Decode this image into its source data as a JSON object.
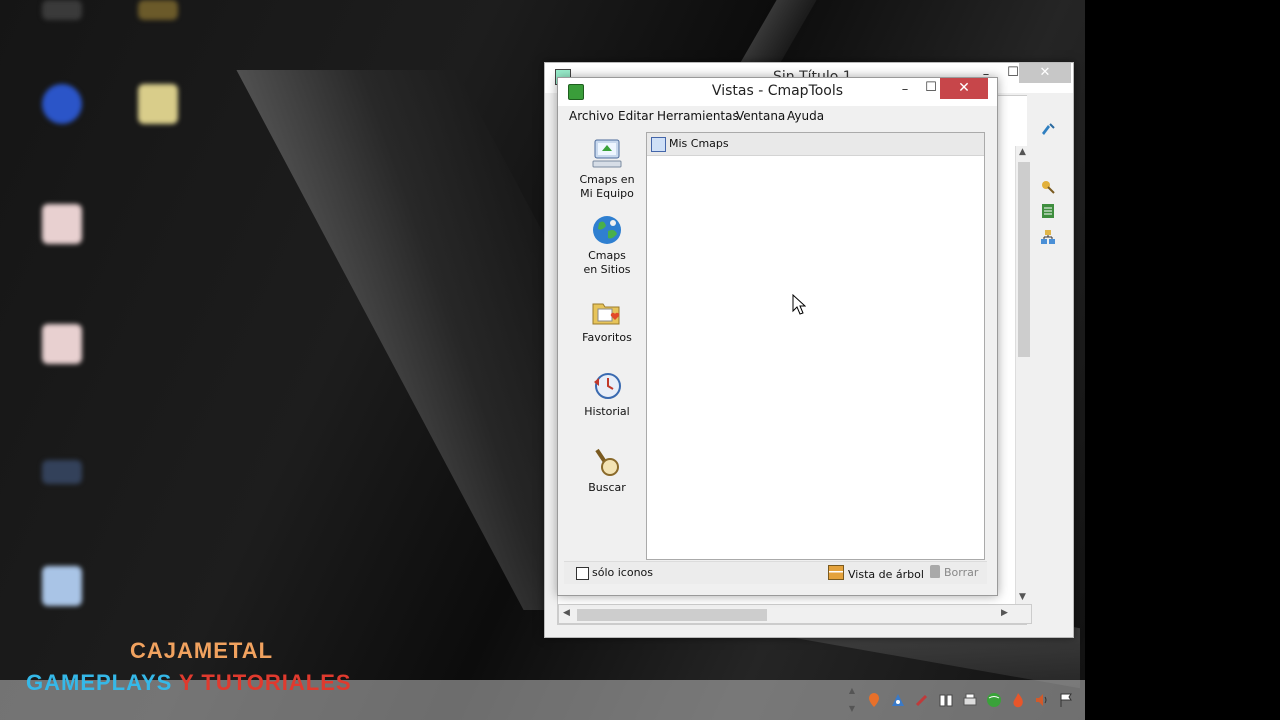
{
  "background_window": {
    "title": "Sin Título 1",
    "min_symbol": "–",
    "max_symbol": "☐",
    "close_symbol": "✕"
  },
  "vistas_window": {
    "title": "Vistas - CmapTools",
    "min_symbol": "–",
    "max_symbol": "☐",
    "close_symbol": "✕",
    "menu": [
      "Archivo",
      "Editar",
      "Herramientas",
      "Ventana",
      "Ayuda"
    ],
    "sidebar": [
      {
        "label": "Cmaps en\nMi Equipo",
        "icon": "computer-icon"
      },
      {
        "label": "Cmaps\nen Sitios",
        "icon": "globe-icon"
      },
      {
        "label": "Favoritos",
        "icon": "favorites-folder-icon"
      },
      {
        "label": "Historial",
        "icon": "history-clock-icon"
      },
      {
        "label": "Buscar",
        "icon": "magnifier-icon"
      }
    ],
    "panel_title": "Mis Cmaps",
    "only_icons_label": "sólo iconos",
    "tree_view_label": "Vista de árbol",
    "delete_label": "Borrar"
  },
  "overlay": {
    "line1": "CAJAMETAL",
    "line2_a": "GAMEPLAYS",
    "line2_b": "Y TUTORIALES"
  },
  "colors": {
    "close_red": "#c7464a",
    "overlay_orange": "#f1a25f",
    "overlay_blue": "#35b8e8",
    "overlay_red": "#e03a2e"
  }
}
